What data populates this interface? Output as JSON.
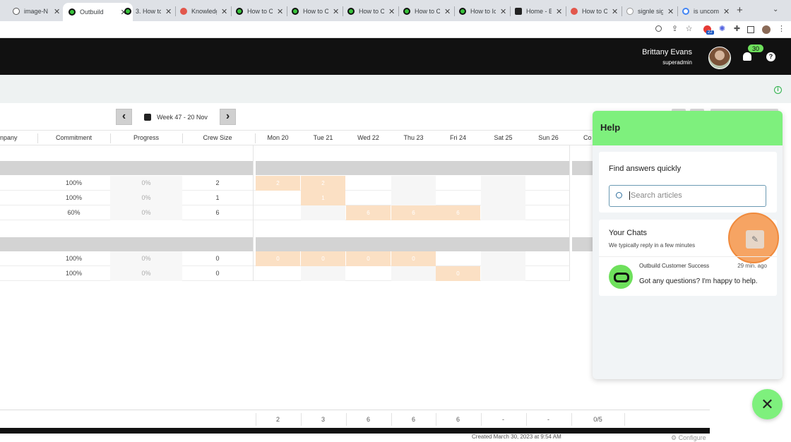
{
  "browser": {
    "tabs": [
      {
        "label": "image-N",
        "icon": "globe-icon"
      },
      {
        "label": "Outbuild",
        "icon": "outbuild-icon",
        "active": true
      },
      {
        "label": "3. How to",
        "icon": "outbuild-icon"
      },
      {
        "label": "Knowledg",
        "icon": "hubspot-icon"
      },
      {
        "label": "How to C",
        "icon": "outbuild-icon"
      },
      {
        "label": "How to C",
        "icon": "outbuild-icon"
      },
      {
        "label": "How to C",
        "icon": "outbuild-icon"
      },
      {
        "label": "How to C",
        "icon": "outbuild-icon"
      },
      {
        "label": "How to Ic",
        "icon": "outbuild-icon"
      },
      {
        "label": "Home - B",
        "icon": "app-icon"
      },
      {
        "label": "How to C",
        "icon": "record-icon"
      },
      {
        "label": "signle sig",
        "icon": "google-icon"
      },
      {
        "label": "is uncom",
        "icon": "google-icon"
      }
    ],
    "new_tab": "+",
    "tab_menu": "⌄",
    "extension_badge": "22"
  },
  "header": {
    "user_name": "Brittany Evans",
    "user_role": "superadmin",
    "notification_count": "30",
    "help_symbol": "?"
  },
  "week_nav": {
    "prev": "‹",
    "label": "Week 47 - 20 Nov",
    "next": "›"
  },
  "table": {
    "columns": {
      "company": "npany",
      "commitment": "Commitment",
      "progress": "Progress",
      "crew": "Crew Size",
      "d1": "Mon 20",
      "d2": "Tue 21",
      "d3": "Wed 22",
      "d4": "Thu 23",
      "d5": "Fri 24",
      "d6": "Sat 25",
      "d7": "Sun 26",
      "d8": "Co"
    },
    "rows": [
      {
        "commitment": "100%",
        "progress": "0%",
        "crew": "2",
        "days": [
          "2",
          "2",
          "",
          "",
          "",
          "",
          ""
        ]
      },
      {
        "commitment": "100%",
        "progress": "0%",
        "crew": "1",
        "days": [
          "",
          "1",
          "",
          "",
          "",
          "",
          ""
        ]
      },
      {
        "commitment": "60%",
        "progress": "0%",
        "crew": "6",
        "days": [
          "",
          "",
          "6",
          "6",
          "6",
          "",
          ""
        ]
      },
      {
        "commitment": "100%",
        "progress": "0%",
        "crew": "0",
        "days": [
          "0",
          "0",
          "0",
          "0",
          "",
          "",
          ""
        ]
      },
      {
        "commitment": "100%",
        "progress": "0%",
        "crew": "0",
        "days": [
          "",
          "",
          "",
          "",
          "0",
          "",
          ""
        ]
      }
    ],
    "totals": {
      "d1": "2",
      "d2": "3",
      "d3": "6",
      "d4": "6",
      "d5": "6",
      "d6": "-",
      "d7": "-",
      "ratio": "0/5"
    }
  },
  "footer": {
    "created": "Created March 30, 2023 at 9:54 AM",
    "configure": "Configure"
  },
  "help_panel": {
    "title": "Help",
    "find_title": "Find answers quickly",
    "search_placeholder": "Search articles",
    "chats_title": "Your Chats",
    "chats_sub": "We typically reply in a few minutes",
    "chat_from": "Outbuild Customer Success",
    "chat_time": "29 min. ago",
    "chat_message": "Got any questions? I'm happy to help.",
    "close_symbol": "✕"
  },
  "colors": {
    "brand_green": "#7ef07d",
    "header_black": "#111111",
    "work_cell": "#fbe0c4",
    "highlight_ring": "#f08a3c"
  }
}
